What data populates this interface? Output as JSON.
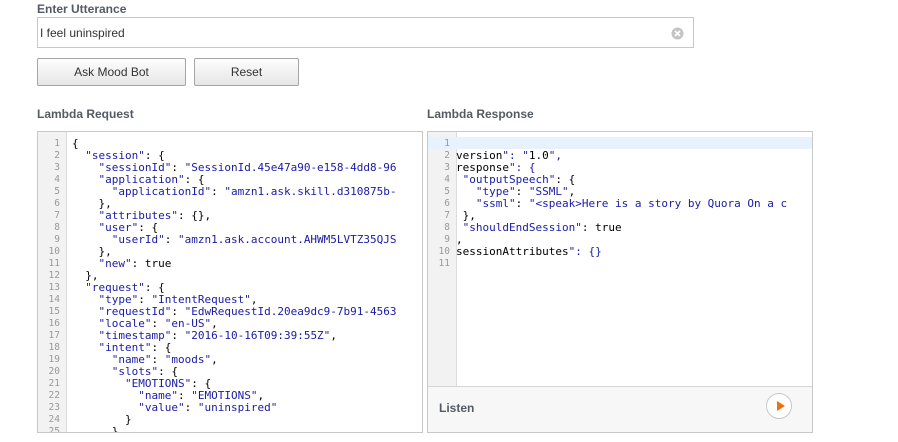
{
  "utterance": {
    "label": "Enter Utterance",
    "value": "I feel uninspired"
  },
  "buttons": {
    "ask": "Ask Mood Bot",
    "reset": "Reset"
  },
  "request": {
    "label": "Lambda Request",
    "lines": [
      {
        "n": "1",
        "t": "{"
      },
      {
        "n": "2",
        "t": "  \"session\": {"
      },
      {
        "n": "3",
        "t": "    \"sessionId\": \"SessionId.45e47a90-e158-4dd8-96"
      },
      {
        "n": "4",
        "t": "    \"application\": {"
      },
      {
        "n": "5",
        "t": "      \"applicationId\": \"amzn1.ask.skill.d310875b-"
      },
      {
        "n": "6",
        "t": "    },"
      },
      {
        "n": "7",
        "t": "    \"attributes\": {},"
      },
      {
        "n": "8",
        "t": "    \"user\": {"
      },
      {
        "n": "9",
        "t": "      \"userId\": \"amzn1.ask.account.AHWM5LVTZ35QJS"
      },
      {
        "n": "10",
        "t": "    },"
      },
      {
        "n": "11",
        "t": "    \"new\": true"
      },
      {
        "n": "12",
        "t": "  },"
      },
      {
        "n": "13",
        "t": "  \"request\": {"
      },
      {
        "n": "14",
        "t": "    \"type\": \"IntentRequest\","
      },
      {
        "n": "15",
        "t": "    \"requestId\": \"EdwRequestId.20ea9dc9-7b91-4563"
      },
      {
        "n": "16",
        "t": "    \"locale\": \"en-US\","
      },
      {
        "n": "17",
        "t": "    \"timestamp\": \"2016-10-16T09:39:55Z\","
      },
      {
        "n": "18",
        "t": "    \"intent\": {"
      },
      {
        "n": "19",
        "t": "      \"name\": \"moods\","
      },
      {
        "n": "20",
        "t": "      \"slots\": {"
      },
      {
        "n": "21",
        "t": "        \"EMOTIONS\": {"
      },
      {
        "n": "22",
        "t": "          \"name\": \"EMOTIONS\","
      },
      {
        "n": "23",
        "t": "          \"value\": \"uninspired\""
      },
      {
        "n": "24",
        "t": "        }"
      },
      {
        "n": "25",
        "t": "      }"
      }
    ]
  },
  "response": {
    "label": "Lambda Response",
    "lines": [
      {
        "n": "1",
        "t": ""
      },
      {
        "n": "2",
        "t": "version\": \"1.0\","
      },
      {
        "n": "3",
        "t": "response\": {"
      },
      {
        "n": "4",
        "t": " \"outputSpeech\": {"
      },
      {
        "n": "5",
        "t": "   \"type\": \"SSML\","
      },
      {
        "n": "6",
        "t": "   \"ssml\": \"<speak>Here is a story by Quora On a c"
      },
      {
        "n": "7",
        "t": " },"
      },
      {
        "n": "8",
        "t": " \"shouldEndSession\": true"
      },
      {
        "n": "9",
        "t": ","
      },
      {
        "n": "10",
        "t": "sessionAttributes\": {}"
      },
      {
        "n": "11",
        "t": ""
      }
    ],
    "footer_label": "Listen"
  },
  "icons": {
    "clear": "clear-icon",
    "play": "play-icon"
  },
  "colors": {
    "accent": "#ec7211",
    "string": "#1a1aa6",
    "active_line": "#e8f2fe"
  }
}
